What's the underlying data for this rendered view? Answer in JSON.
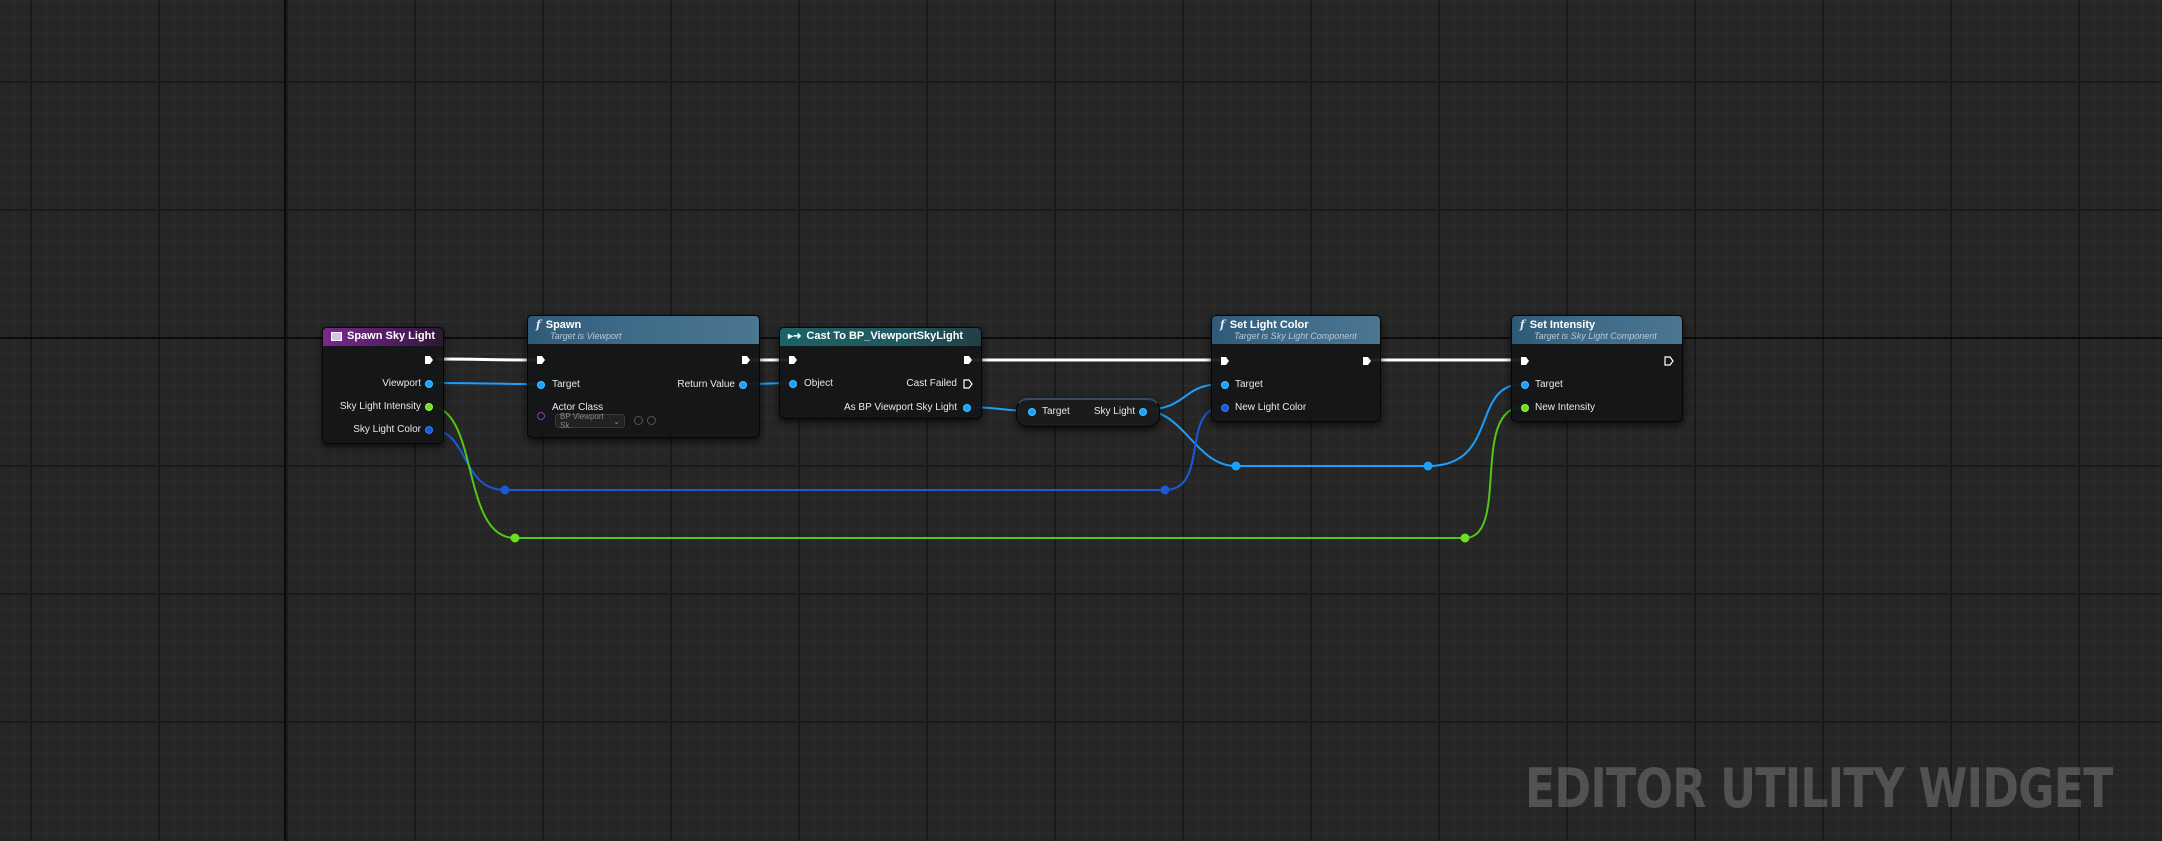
{
  "watermark": "EDITOR UTILITY WIDGET",
  "nodes": {
    "spawn_sky_light": {
      "title": "Spawn Sky Light",
      "pins": [
        "Viewport",
        "Sky Light Intensity",
        "Sky Light Color"
      ]
    },
    "spawn": {
      "title": "Spawn",
      "subtitle": "Target is Viewport",
      "target": "Target",
      "return_value": "Return Value",
      "actor_class_label": "Actor Class",
      "actor_class_value": "BP Viewport Sk"
    },
    "cast": {
      "title": "Cast To BP_ViewportSkyLight",
      "object": "Object",
      "cast_failed": "Cast Failed",
      "as_output": "As BP Viewport Sky Light"
    },
    "getter": {
      "target": "Target",
      "output": "Sky Light"
    },
    "set_light_color": {
      "title": "Set Light Color",
      "subtitle": "Target is Sky Light Component",
      "target": "Target",
      "new_value": "New Light Color"
    },
    "set_intensity": {
      "title": "Set Intensity",
      "subtitle": "Target is Sky Light Component",
      "target": "Target",
      "new_value": "New Intensity"
    }
  },
  "colors": {
    "object_pin": "#1aa0ff",
    "float_pin": "#6be01e",
    "color_pin": "#1a5ad8",
    "exec": "#ffffff",
    "event_header": "#7a2a8c",
    "function_header": "#3d6a88",
    "cast_header": "#1c6266"
  }
}
